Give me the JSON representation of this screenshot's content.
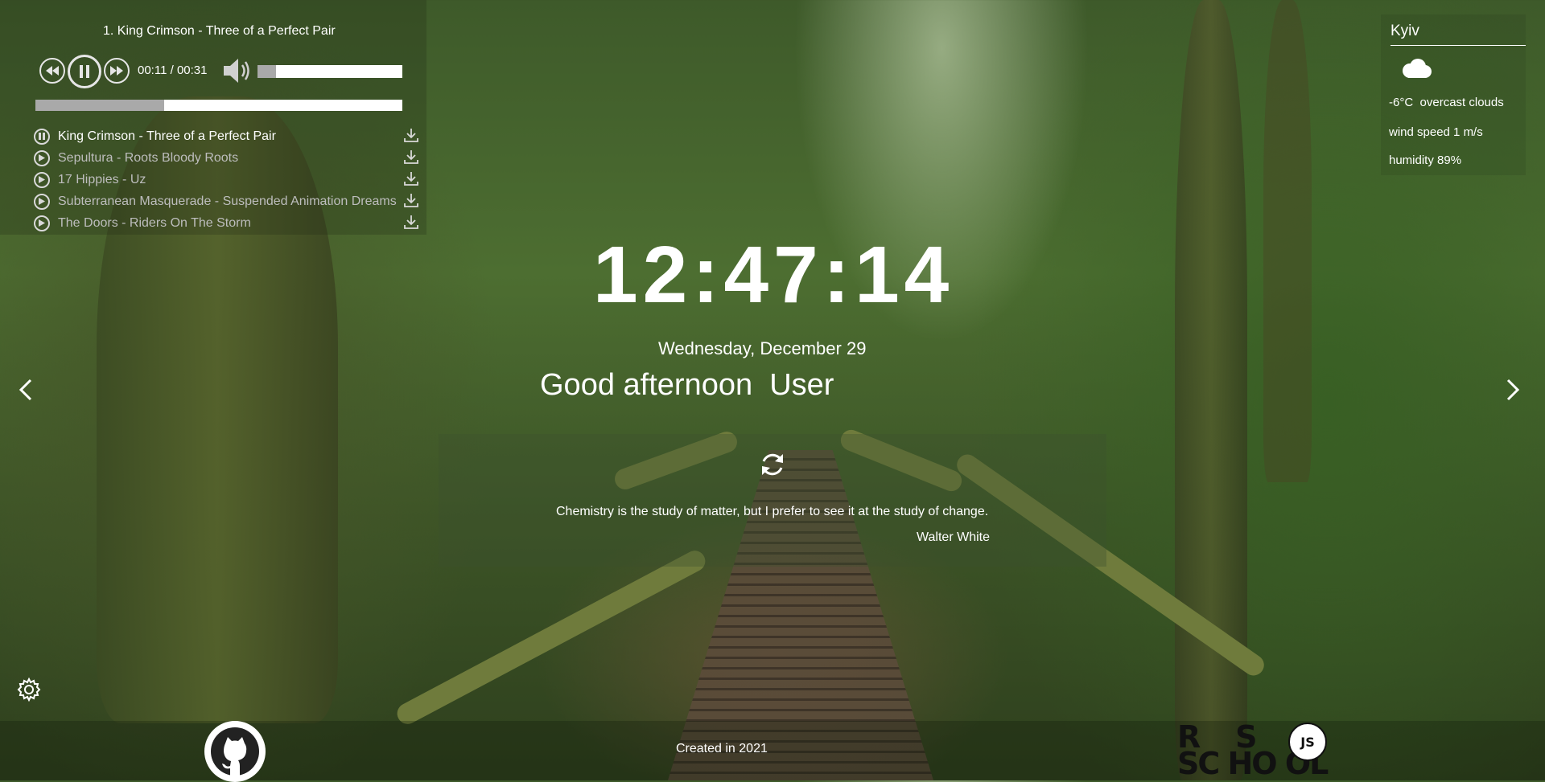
{
  "player": {
    "current_title": "1. King Crimson - Three of a Perfect Pair",
    "current_time": "00:11",
    "duration": "00:31",
    "time_separator": " / ",
    "progress_fraction": 0.35,
    "volume_fraction": 0.13,
    "state": "playing",
    "playlist": [
      {
        "title": "King Crimson - Three of a Perfect Pair",
        "active": true
      },
      {
        "title": "Sepultura - Roots Bloody Roots",
        "active": false
      },
      {
        "title": "17 Hippies - Uz",
        "active": false
      },
      {
        "title": "Subterranean Masquerade - Suspended Animation Dreams",
        "active": false
      },
      {
        "title": "The Doors - Riders On The Storm",
        "active": false
      }
    ]
  },
  "weather": {
    "city": "Kyiv",
    "icon": "cloud-icon",
    "temperature": "-6°C",
    "description": "overcast clouds",
    "wind": "wind speed 1 m/s",
    "humidity": "humidity 89%"
  },
  "clock": {
    "time": "12:47:14",
    "date": "Wednesday, December 29",
    "greeting": "Good afternoon",
    "name": "User"
  },
  "quote": {
    "text": "Chemistry is the study of matter, but I prefer to see it at the study of change.",
    "author": "Walter White"
  },
  "footer": {
    "created": "Created in 2021",
    "rs_top": "R    S",
    "rs_bottom": "SC HO OL",
    "rs_badge": "JS"
  },
  "icons": {
    "prev": "rewind-icon",
    "pause": "pause-icon",
    "next": "fast-forward-icon",
    "volume": "volume-icon",
    "download": "download-icon",
    "refresh": "refresh-icon",
    "settings": "gear-icon",
    "github": "github-icon",
    "slide_prev": "chevron-left-icon",
    "slide_next": "chevron-right-icon"
  }
}
